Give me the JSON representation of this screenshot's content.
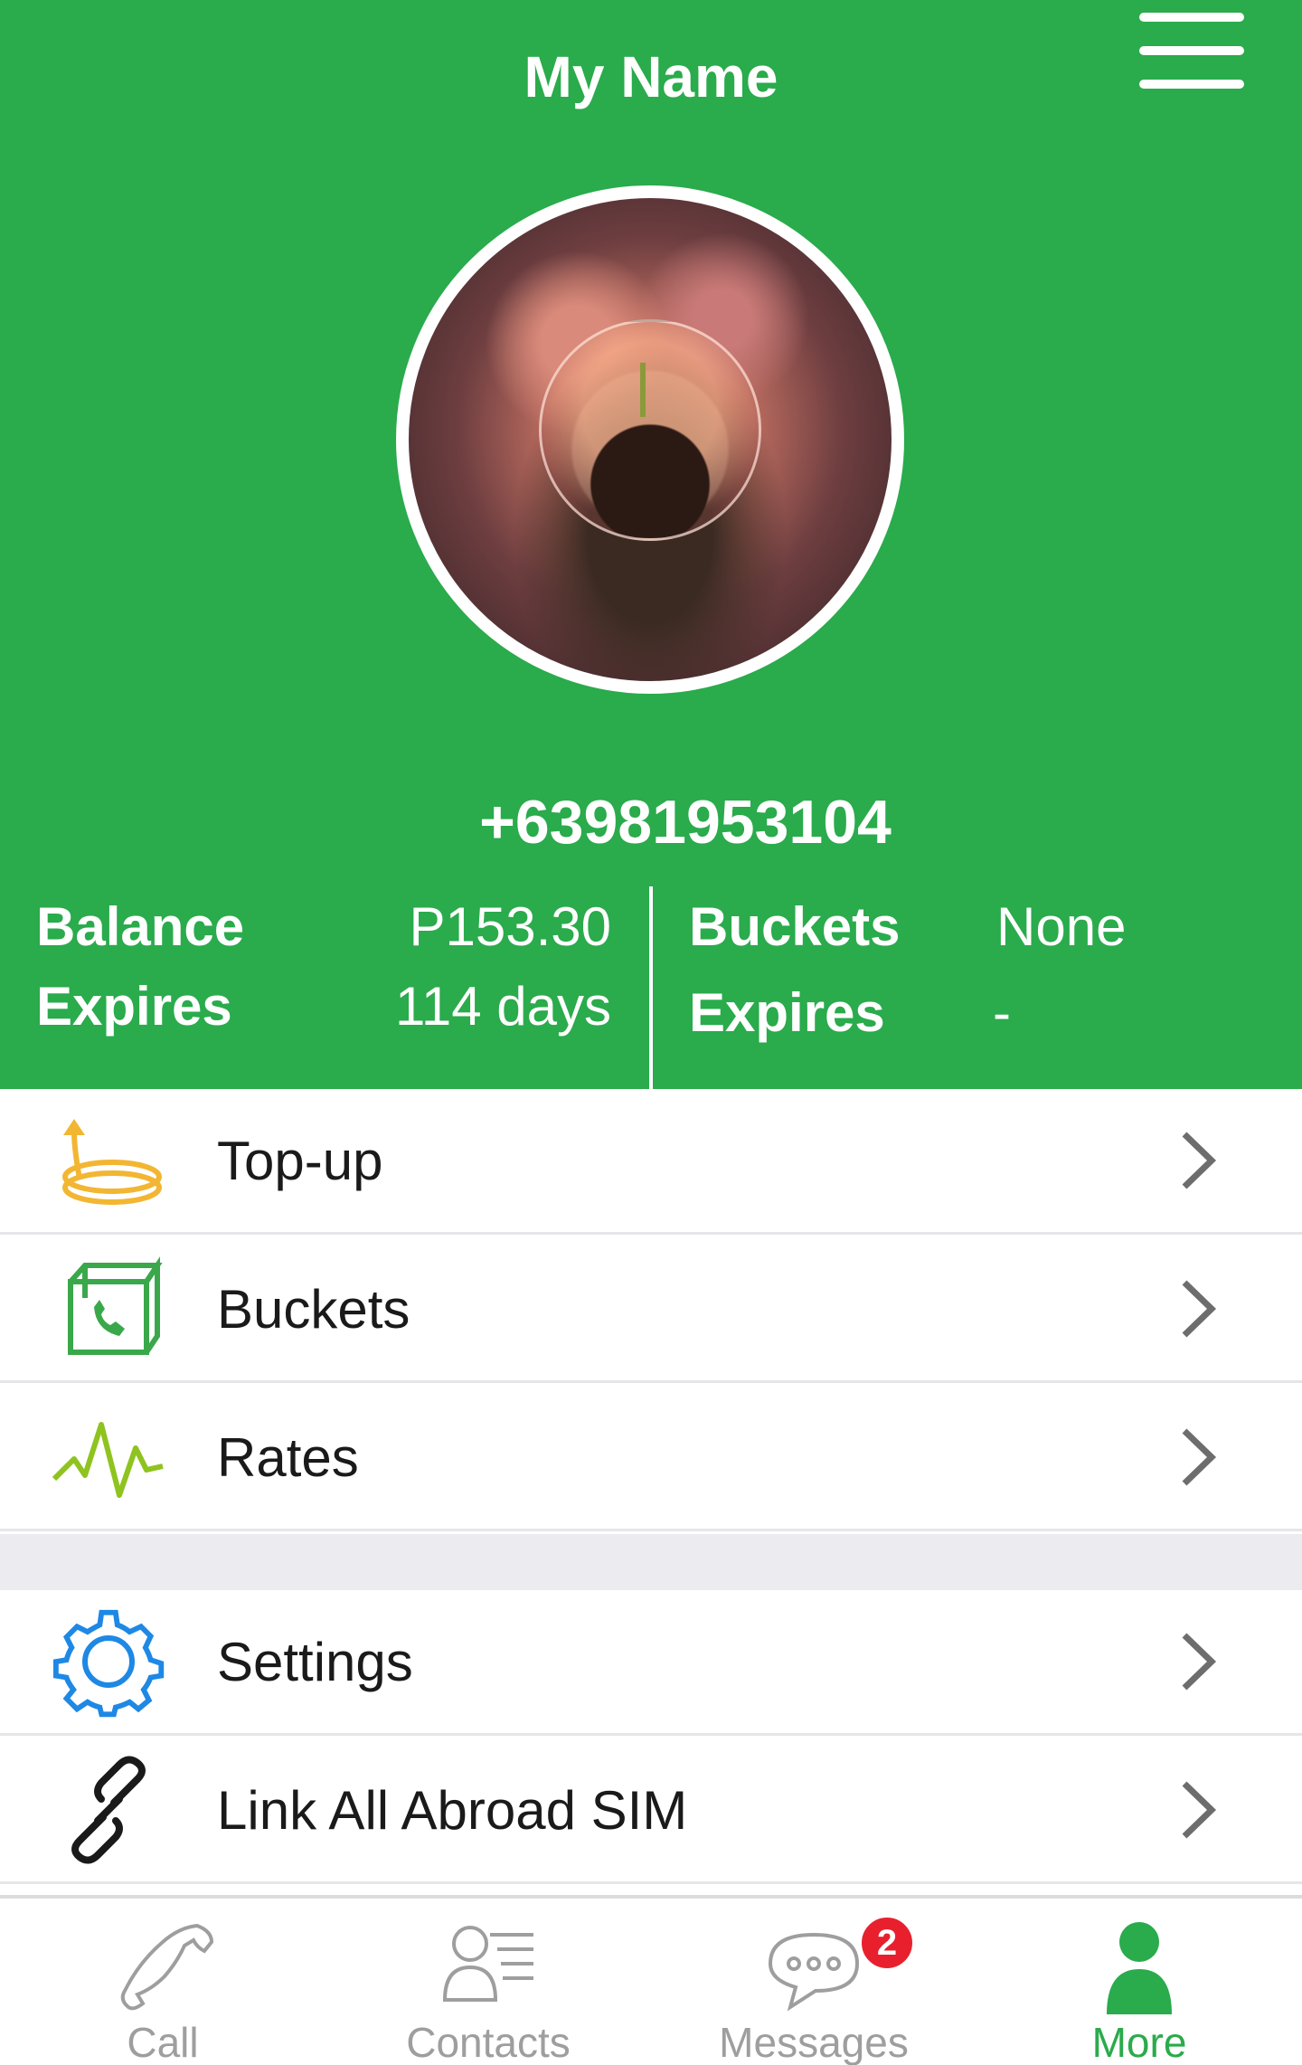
{
  "header": {
    "title": "My Name",
    "phone": "+63981953104",
    "balance": {
      "label": "Balance",
      "value": "P153.30"
    },
    "balance_expires": {
      "label": "Expires",
      "value": "114 days"
    },
    "buckets": {
      "label": "Buckets",
      "value": "None"
    },
    "buckets_expires": {
      "label": "Expires",
      "value": "-"
    }
  },
  "menu": {
    "items": [
      {
        "label": "Top-up",
        "icon": "coins-arrow-icon"
      },
      {
        "label": "Buckets",
        "icon": "box-phone-icon"
      },
      {
        "label": "Rates",
        "icon": "pulse-icon"
      },
      {
        "label": "Settings",
        "icon": "gear-icon"
      },
      {
        "label": "Link All Abroad SIM",
        "icon": "link-icon"
      }
    ]
  },
  "nav": {
    "items": [
      {
        "label": "Call",
        "icon": "phone-icon"
      },
      {
        "label": "Contacts",
        "icon": "contacts-icon"
      },
      {
        "label": "Messages",
        "icon": "chat-icon",
        "badge": "2"
      },
      {
        "label": "More",
        "icon": "person-icon",
        "active": true
      }
    ]
  },
  "colors": {
    "brand": "#2aab4c",
    "badge": "#e8202e",
    "inactive": "#9e9e9e",
    "settings_icon": "#1e88e5",
    "topup_icon": "#f2b632"
  }
}
